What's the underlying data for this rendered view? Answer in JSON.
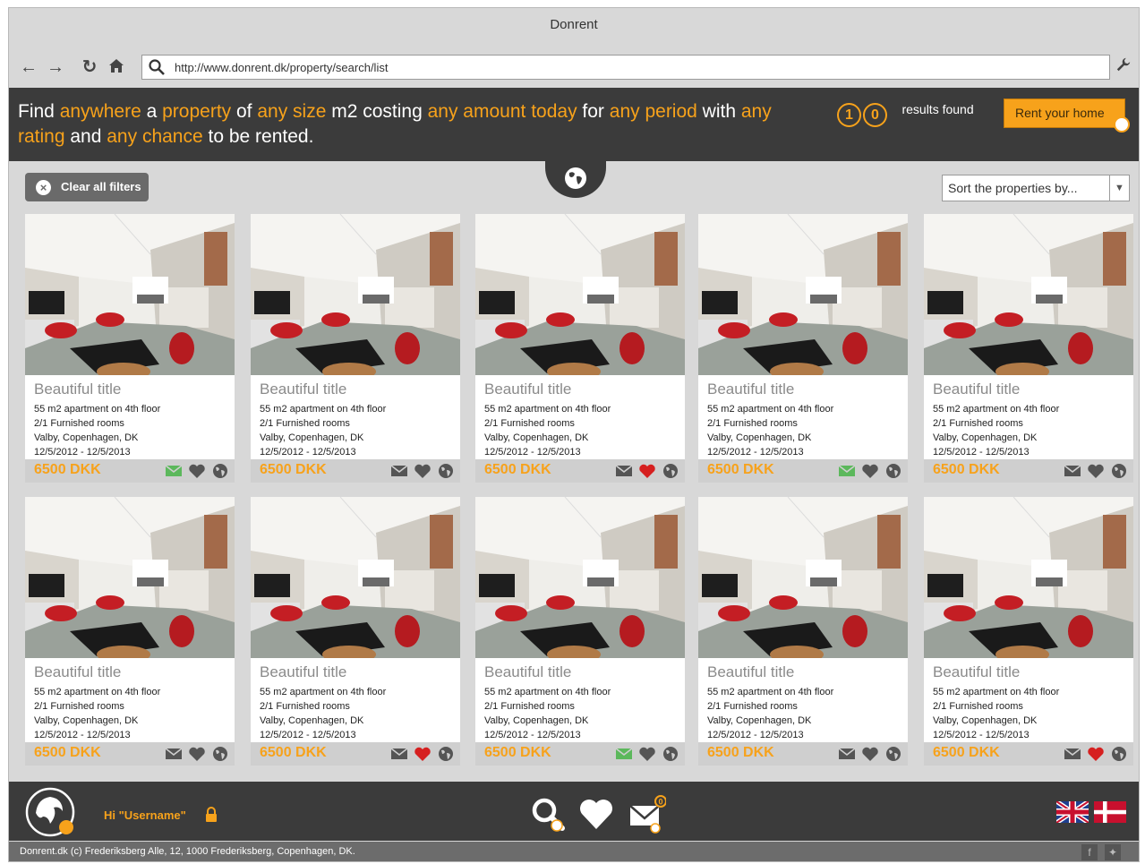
{
  "window": {
    "title": "Donrent"
  },
  "toolbar": {
    "url": "http://www.donrent.dk/property/search/list"
  },
  "header": {
    "sentence": [
      {
        "text": "Find ",
        "hl": false
      },
      {
        "text": "anywhere",
        "hl": true
      },
      {
        "text": " a ",
        "hl": false
      },
      {
        "text": "property",
        "hl": true
      },
      {
        "text": " of ",
        "hl": false
      },
      {
        "text": "any size",
        "hl": true
      },
      {
        "text": " m2 costing ",
        "hl": false
      },
      {
        "text": "any amount",
        "hl": true
      },
      {
        "text": " ",
        "hl": false
      },
      {
        "text": "today",
        "hl": true
      },
      {
        "text": " for ",
        "hl": false
      },
      {
        "text": "any period",
        "hl": true
      },
      {
        "text": " with ",
        "hl": false
      },
      {
        "text": "any rating",
        "hl": true
      },
      {
        "text": " and ",
        "hl": false
      },
      {
        "text": "any chance",
        "hl": true
      },
      {
        "text": " to be rented.",
        "hl": false
      }
    ],
    "results_digits": [
      "1",
      "0"
    ],
    "results_label": "results found",
    "rent_button": "Rent your home"
  },
  "filters": {
    "clear_label": "Clear all filters",
    "sort_placeholder": "Sort the properties by..."
  },
  "listings": [
    {
      "title": "Beautiful title",
      "line1": "55 m2 apartment on 4th floor",
      "line2": "2/1 Furnished rooms",
      "line3": "Valby, Copenhagen, DK",
      "line4": "12/5/2012 - 12/5/2013",
      "price": "6500 DKK",
      "mail_active": true,
      "heart_active": false
    },
    {
      "title": "Beautiful title",
      "line1": "55 m2 apartment on 4th floor",
      "line2": "2/1 Furnished rooms",
      "line3": "Valby, Copenhagen, DK",
      "line4": "12/5/2012 - 12/5/2013",
      "price": "6500 DKK",
      "mail_active": false,
      "heart_active": false
    },
    {
      "title": "Beautiful title",
      "line1": "55 m2 apartment on 4th floor",
      "line2": "2/1 Furnished rooms",
      "line3": "Valby, Copenhagen, DK",
      "line4": "12/5/2012 - 12/5/2013",
      "price": "6500 DKK",
      "mail_active": false,
      "heart_active": true
    },
    {
      "title": "Beautiful title",
      "line1": "55 m2 apartment on 4th floor",
      "line2": "2/1 Furnished rooms",
      "line3": "Valby, Copenhagen, DK",
      "line4": "12/5/2012 - 12/5/2013",
      "price": "6500 DKK",
      "mail_active": true,
      "heart_active": false
    },
    {
      "title": "Beautiful title",
      "line1": "55 m2 apartment on 4th floor",
      "line2": "2/1 Furnished rooms",
      "line3": "Valby, Copenhagen, DK",
      "line4": "12/5/2012 - 12/5/2013",
      "price": "6500 DKK",
      "mail_active": false,
      "heart_active": false
    },
    {
      "title": "Beautiful title",
      "line1": "55 m2 apartment on 4th floor",
      "line2": "2/1 Furnished rooms",
      "line3": "Valby, Copenhagen, DK",
      "line4": "12/5/2012 - 12/5/2013",
      "price": "6500 DKK",
      "mail_active": false,
      "heart_active": false
    },
    {
      "title": "Beautiful title",
      "line1": "55 m2 apartment on 4th floor",
      "line2": "2/1 Furnished rooms",
      "line3": "Valby, Copenhagen, DK",
      "line4": "12/5/2012 - 12/5/2013",
      "price": "6500 DKK",
      "mail_active": false,
      "heart_active": true
    },
    {
      "title": "Beautiful title",
      "line1": "55 m2 apartment on 4th floor",
      "line2": "2/1 Furnished rooms",
      "line3": "Valby, Copenhagen, DK",
      "line4": "12/5/2012 - 12/5/2013",
      "price": "6500 DKK",
      "mail_active": true,
      "heart_active": false
    },
    {
      "title": "Beautiful title",
      "line1": "55 m2 apartment on 4th floor",
      "line2": "2/1 Furnished rooms",
      "line3": "Valby, Copenhagen, DK",
      "line4": "12/5/2012 - 12/5/2013",
      "price": "6500 DKK",
      "mail_active": false,
      "heart_active": false
    },
    {
      "title": "Beautiful title",
      "line1": "55 m2 apartment on 4th floor",
      "line2": "2/1 Furnished rooms",
      "line3": "Valby, Copenhagen, DK",
      "line4": "12/5/2012 - 12/5/2013",
      "price": "6500 DKK",
      "mail_active": false,
      "heart_active": true
    }
  ],
  "footer": {
    "greeting": "Hi \"Username\"",
    "message_count": "0",
    "copyright": "Donrent.dk (c) Frederiksberg Alle, 12, 1000 Frederiksberg, Copenhagen, DK."
  },
  "colors": {
    "accent": "#f7a21b",
    "dark": "#3b3b3b",
    "mail_active": "#5cb85c",
    "heart_active": "#d62020"
  },
  "icons": [
    "back-arrow-icon",
    "forward-arrow-icon",
    "reload-icon",
    "home-icon",
    "search-icon",
    "wrench-icon",
    "globe-icon",
    "clear-icon",
    "mail-icon",
    "heart-icon",
    "share-icon",
    "logo-icon",
    "lock-icon",
    "flag-uk-icon",
    "flag-dk-icon"
  ]
}
